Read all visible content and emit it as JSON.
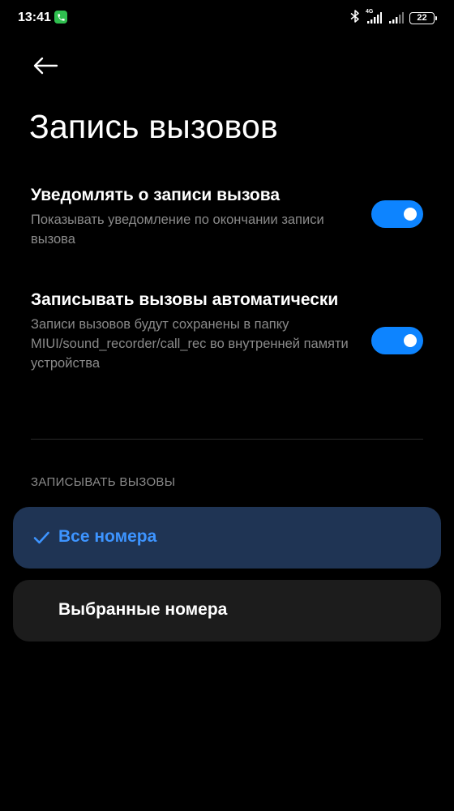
{
  "status_bar": {
    "time": "13:41",
    "network_label": "4G",
    "battery_level": "22"
  },
  "header": {
    "title": "Запись вызовов"
  },
  "settings": [
    {
      "title": "Уведомлять о записи вызова",
      "description": "Показывать уведомление по окончании записи вызова",
      "enabled": true
    },
    {
      "title": "Записывать вызовы автоматически",
      "description": "Записи вызовов будут сохранены в папку MIUI/sound_recorder/call_rec во внутренней памяти устройства",
      "enabled": true
    }
  ],
  "record_section": {
    "header": "ЗАПИСЫВАТЬ ВЫЗОВЫ",
    "options": [
      {
        "label": "Все номера",
        "selected": true
      },
      {
        "label": "Выбранные номера",
        "selected": false
      }
    ]
  },
  "colors": {
    "accent": "#0d84ff",
    "selected_text": "#3d94ff",
    "selected_bg": "#1f3454",
    "background": "#000000"
  }
}
